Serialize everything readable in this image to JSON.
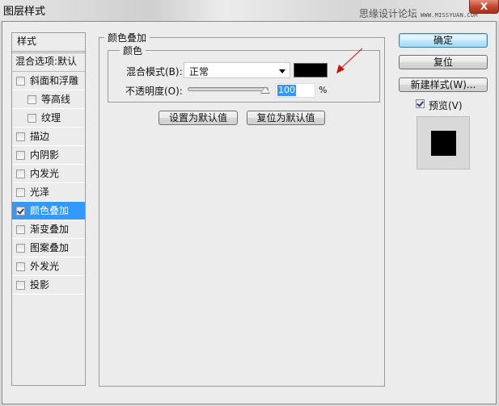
{
  "window": {
    "title": "图层样式",
    "close_label": "X",
    "watermark_cn": "思缘设计论坛",
    "watermark_url": "WWW.MISSYUAN.COM"
  },
  "sidebar": {
    "header": "样式",
    "blend_options": "混合选项:默认",
    "items": [
      {
        "label": "斜面和浮雕",
        "checked": false,
        "indent": false,
        "selected": false
      },
      {
        "label": "等高线",
        "checked": false,
        "indent": true,
        "selected": false
      },
      {
        "label": "纹理",
        "checked": false,
        "indent": true,
        "selected": false
      },
      {
        "label": "描边",
        "checked": false,
        "indent": false,
        "selected": false
      },
      {
        "label": "内阴影",
        "checked": false,
        "indent": false,
        "selected": false
      },
      {
        "label": "内发光",
        "checked": false,
        "indent": false,
        "selected": false
      },
      {
        "label": "光泽",
        "checked": false,
        "indent": false,
        "selected": false
      },
      {
        "label": "颜色叠加",
        "checked": true,
        "indent": false,
        "selected": true
      },
      {
        "label": "渐变叠加",
        "checked": false,
        "indent": false,
        "selected": false
      },
      {
        "label": "图案叠加",
        "checked": false,
        "indent": false,
        "selected": false
      },
      {
        "label": "外发光",
        "checked": false,
        "indent": false,
        "selected": false
      },
      {
        "label": "投影",
        "checked": false,
        "indent": false,
        "selected": false
      }
    ]
  },
  "panel": {
    "group_title": "颜色叠加",
    "subgroup_title": "颜色",
    "blend_mode_label": "混合模式(B):",
    "blend_mode_value": "正常",
    "overlay_color": "#000000",
    "opacity_label": "不透明度(O):",
    "opacity_value": "100",
    "opacity_percent": 100,
    "percent_sign": "%",
    "set_default_label": "设置为默认值",
    "reset_default_label": "复位为默认值"
  },
  "actions": {
    "ok_label": "确定",
    "reset_label": "复位",
    "new_style_label": "新建样式(W)...",
    "preview_label": "预览(V)",
    "preview_checked": true,
    "preview_color": "#000000"
  },
  "annotation": {
    "arrow_color": "#cc1111"
  }
}
